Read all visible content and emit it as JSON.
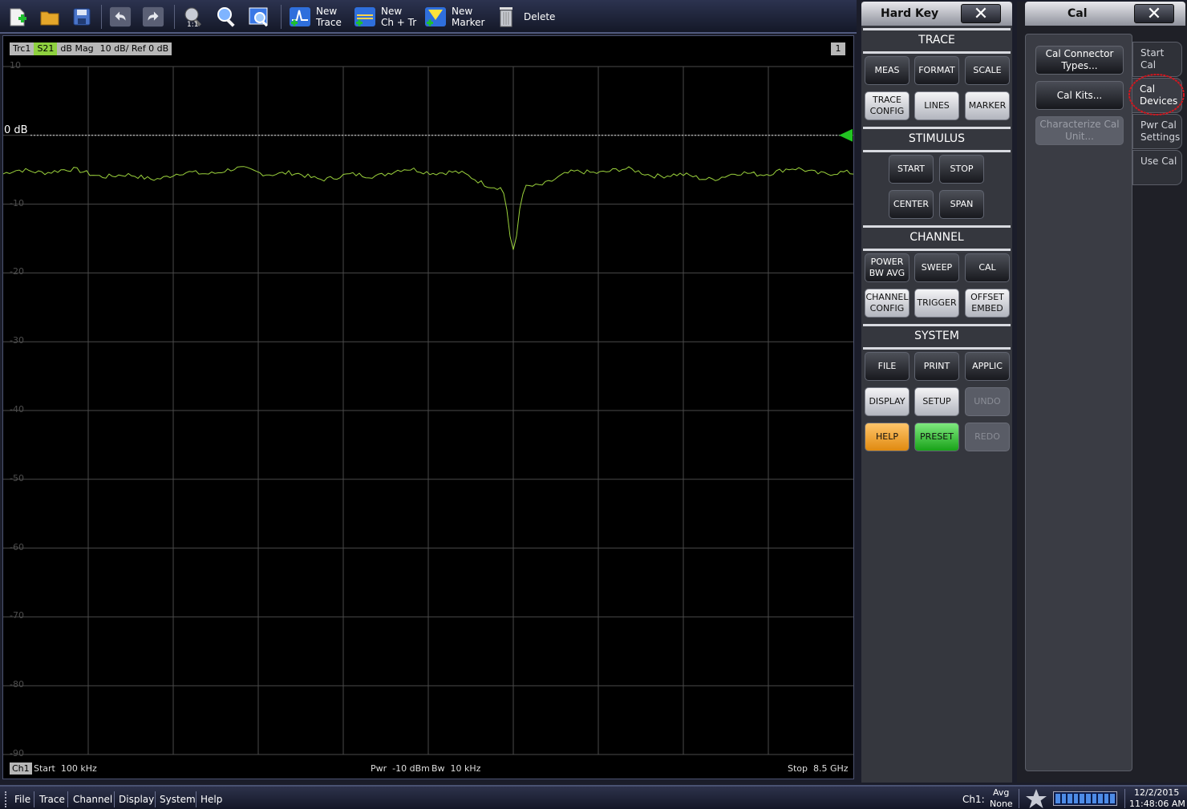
{
  "toolbar": {
    "new_trace_l1": "New",
    "new_trace_l2": "Trace",
    "new_chtr_l1": "New",
    "new_chtr_l2": "Ch + Tr",
    "new_marker_l1": "New",
    "new_marker_l2": "Marker",
    "delete": "Delete"
  },
  "diagram": {
    "trace_name": "Trc1",
    "param": "S21",
    "format": "dB Mag",
    "scale": "10 dB/ Ref 0 dB",
    "window_num": "1",
    "ref_label": "0 dB",
    "y_ticks": [
      "10",
      "0",
      "-10",
      "-20",
      "-30",
      "-40",
      "-50",
      "-60",
      "-70",
      "-80",
      "-90"
    ],
    "footer": {
      "channel": "Ch1",
      "start": "Start  100 kHz",
      "power": "Pwr  -10 dBm",
      "bw": "Bw  10 kHz",
      "stop": "Stop  8.5 GHz"
    },
    "trace_color": "#9bd23c",
    "marker_color": "#22c322"
  },
  "hardkey": {
    "title": "Hard Key",
    "close": "✕",
    "sections": {
      "trace": "TRACE",
      "stimulus": "STIMULUS",
      "channel": "CHANNEL",
      "system": "SYSTEM"
    },
    "buttons": {
      "meas": "MEAS",
      "format": "FORMAT",
      "scale": "SCALE",
      "trace_config": "TRACE CONFIG",
      "lines": "LINES",
      "marker": "MARKER",
      "start": "START",
      "stop": "STOP",
      "center": "CENTER",
      "span": "SPAN",
      "power_bw_avg": "POWER BW AVG",
      "sweep": "SWEEP",
      "cal": "CAL",
      "channel_config": "CHANNEL CONFIG",
      "trigger": "TRIGGER",
      "offset_embed": "OFFSET EMBED",
      "file": "FILE",
      "print": "PRINT",
      "applic": "APPLIC",
      "display": "DISPLAY",
      "setup": "SETUP",
      "undo": "UNDO",
      "help": "HELP",
      "preset": "PRESET",
      "redo": "REDO"
    }
  },
  "cal": {
    "title": "Cal",
    "close": "✕",
    "buttons": {
      "connector_types": "Cal Connector Types...",
      "cal_kits": "Cal Kits...",
      "characterize": "Characterize Cal Unit..."
    },
    "tabs": {
      "start_cal": "Start Cal",
      "cal_devices": "Cal Devices",
      "pwr_cal_settings": "Pwr Cal Settings",
      "use_cal": "Use Cal"
    },
    "highlight_color": "#d0161e"
  },
  "status": {
    "menus": [
      "File",
      "Trace",
      "Channel",
      "Display",
      "System",
      "Help"
    ],
    "channel": "Ch1:",
    "avg": "Avg",
    "avg_value": "None",
    "date": "12/2/2015",
    "time": "11:48:06 AM"
  }
}
